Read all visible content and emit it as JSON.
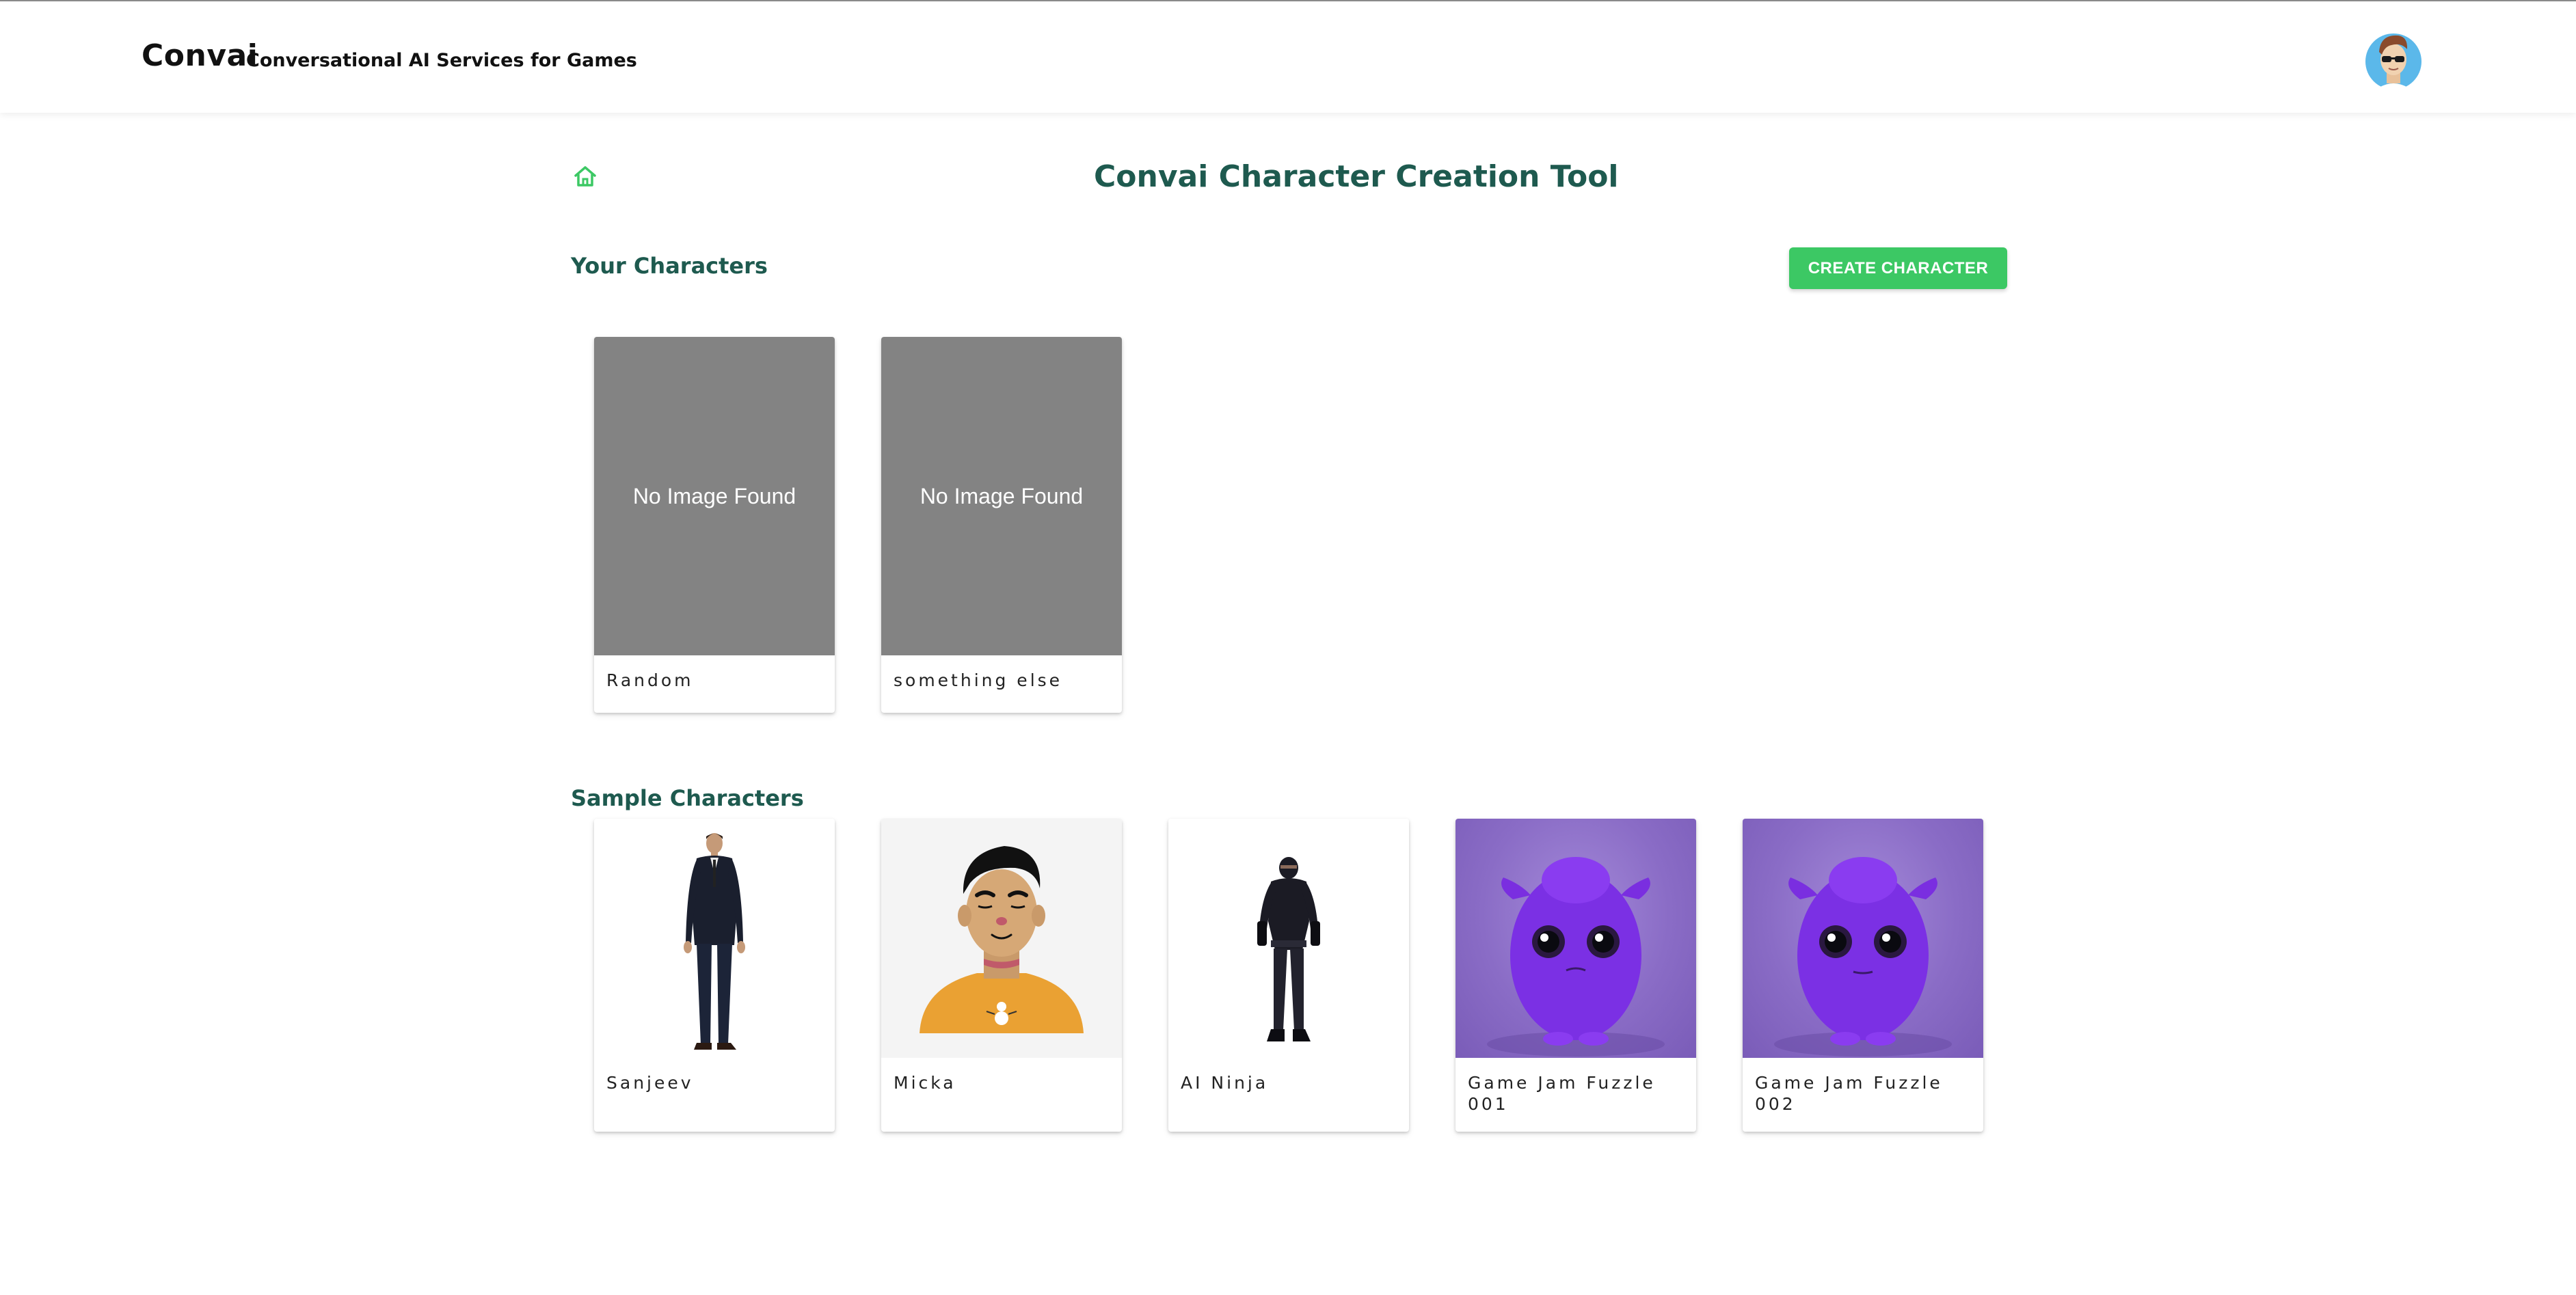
{
  "header": {
    "brand": "Convai",
    "tagline": "Conversational AI Services for Games"
  },
  "page": {
    "title": "Convai Character Creation Tool"
  },
  "your_characters": {
    "heading": "Your Characters",
    "create_button": "CREATE CHARACTER",
    "placeholder_text": "No Image Found",
    "items": [
      {
        "name": "Random",
        "image": "none"
      },
      {
        "name": "something else",
        "image": "none"
      }
    ]
  },
  "sample_characters": {
    "heading": "Sample Characters",
    "items": [
      {
        "name": "Sanjeev",
        "image": "man-in-suit"
      },
      {
        "name": "Micka",
        "image": "cartoon-man-orange-sweater"
      },
      {
        "name": "AI Ninja",
        "image": "ninja"
      },
      {
        "name": "Game Jam Fuzzle 001",
        "image": "purple-fuzzy-monster"
      },
      {
        "name": "Game Jam Fuzzle 002",
        "image": "purple-fuzzy-monster"
      }
    ]
  },
  "colors": {
    "accent_green": "#3cc864",
    "heading_teal": "#1e5a4f",
    "placeholder_gray": "#838383",
    "monster_purple": "#8a6cc6"
  }
}
